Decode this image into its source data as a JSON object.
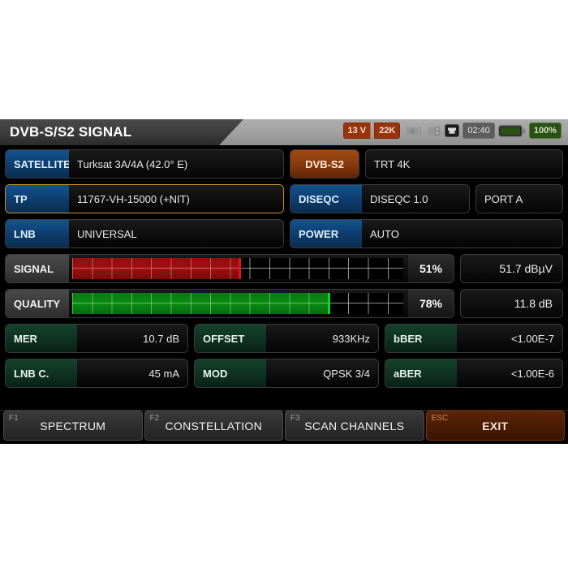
{
  "header": {
    "title": "DVB-S/S2 SIGNAL",
    "status": {
      "voltage": "13 V",
      "tone": "22K",
      "camera_icon": "camera-icon",
      "usb_icon": "usb-icon",
      "lan_icon": "lan-icon",
      "clock": "02:40",
      "battery_icon": "battery-icon",
      "battery_percent": "100%"
    }
  },
  "fields": {
    "satellite": {
      "label": "SATELLITE",
      "value": "Turksat 3A/4A (42.0° E)"
    },
    "standard": {
      "label": "DVB-S2"
    },
    "channel": {
      "value": "TRT 4K"
    },
    "tp": {
      "label": "TP",
      "value": "11767-VH-15000 (+NIT)"
    },
    "diseqc": {
      "label": "DISEQC",
      "value": "DISEQC 1.0"
    },
    "port": {
      "value": "PORT A"
    },
    "lnb": {
      "label": "LNB",
      "value": "UNIVERSAL"
    },
    "power": {
      "label": "POWER",
      "value": "AUTO"
    }
  },
  "bars": {
    "signal": {
      "label": "SIGNAL",
      "percent_label": "51%",
      "percent": 51,
      "reading": "51.7 dBµV",
      "color": "#a01010"
    },
    "quality": {
      "label": "QUALITY",
      "percent_label": "78%",
      "percent": 78,
      "reading": "11.8 dB",
      "color": "#0c8a14"
    }
  },
  "measurements": {
    "mer": {
      "label": "MER",
      "value": "10.7 dB"
    },
    "offset": {
      "label": "OFFSET",
      "value": "933KHz"
    },
    "bber": {
      "label": "bBER",
      "value": "<1.00E-7"
    },
    "lnbc": {
      "label": "LNB C.",
      "value": "45 mA"
    },
    "mod": {
      "label": "MOD",
      "value": "QPSK 3/4"
    },
    "aber": {
      "label": "aBER",
      "value": "<1.00E-6"
    }
  },
  "function_keys": [
    {
      "hint": "F1",
      "label": "SPECTRUM"
    },
    {
      "hint": "F2",
      "label": "CONSTELLATION"
    },
    {
      "hint": "F3",
      "label": "SCAN CHANNELS"
    },
    {
      "hint": "ESC",
      "label": "EXIT"
    }
  ],
  "colors": {
    "accent": "#d0661f",
    "label_blue": "#0d3c6b",
    "label_green": "#0e3122",
    "label_orange": "#86380c",
    "signal_red": "#a01010",
    "quality_green": "#0c8a14",
    "selection_border": "#c8902f"
  }
}
